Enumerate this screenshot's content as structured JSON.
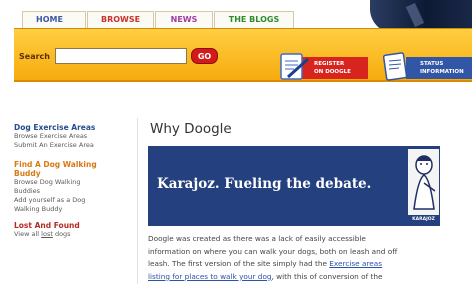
{
  "nav": {
    "tabs": [
      {
        "label": "HOME"
      },
      {
        "label": "BROWSE"
      },
      {
        "label": "NEWS"
      },
      {
        "label": "THE BLOGS"
      }
    ]
  },
  "search": {
    "label": "Search",
    "value": "",
    "button_label": "GO"
  },
  "actions": {
    "register_line1": "REGISTER",
    "register_line2": "ON DOOGLE",
    "status_line1": "STATUS",
    "status_line2": "INFORMATION"
  },
  "sidebar": {
    "exercise": {
      "title": "Dog Exercise Areas",
      "links": [
        "Browse Exercise Areas",
        "Submit An Exercise Area"
      ]
    },
    "walking": {
      "title_line1": "Find A Dog Walking",
      "title_line2": "Buddy",
      "links": [
        "Browse Dog Walking",
        "Buddies",
        "Add yourself as a Dog",
        "Walking Buddy"
      ]
    },
    "lost": {
      "title": "Lost And Found",
      "link_prefix": "View all ",
      "link_underlined": "lost",
      "link_suffix": " dogs"
    }
  },
  "main": {
    "title": "Why Doogle",
    "banner_text": "Karajoz. Fueling the debate.",
    "banner_art_label": "KARAJOZ",
    "paragraph": {
      "line1": "Doogle was created  as there was a lack of easily accessible",
      "line2": "information on where you can walk your dogs, both on leash and off",
      "line3_prefix": "leash. The first version of the site simply had the ",
      "line3_link": "Exercise areas",
      "line4_link": "listing for places to walk your dog",
      "line4_suffix": ", with this of conversion of the"
    }
  },
  "colors": {
    "accent_orange": "#f6ab0f",
    "brand_blue": "#24407f",
    "go_red": "#d41a18"
  }
}
